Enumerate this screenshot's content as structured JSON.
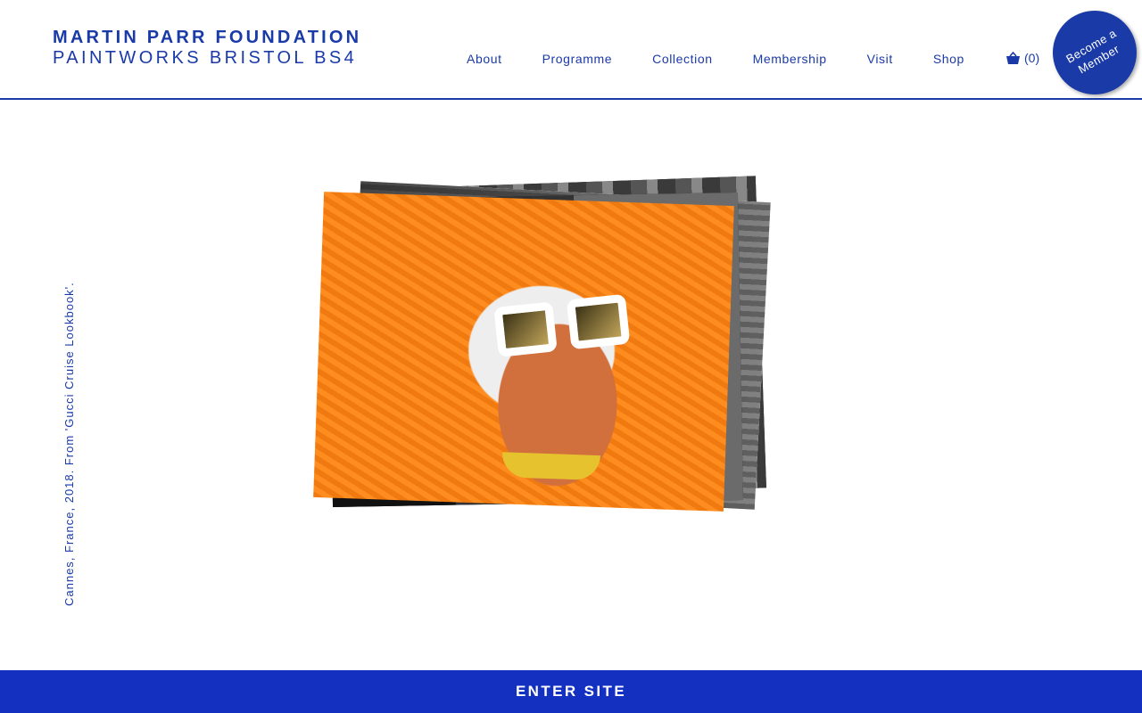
{
  "brand": {
    "line1": "MARTIN PARR FOUNDATION",
    "line2": "PAINTWORKS BRISTOL BS4"
  },
  "nav": {
    "items": [
      {
        "label": "About"
      },
      {
        "label": "Programme"
      },
      {
        "label": "Collection"
      },
      {
        "label": "Membership"
      },
      {
        "label": "Visit"
      },
      {
        "label": "Shop"
      }
    ]
  },
  "basket": {
    "icon": "basket-icon",
    "count_label": "(0)"
  },
  "member_badge": {
    "line1": "Become a",
    "line2": "Member"
  },
  "caption": {
    "text": "Cannes, France, 2018. From 'Gucci Cruise Lookbook'."
  },
  "enter": {
    "label": "ENTER SITE"
  },
  "colors": {
    "brand_blue": "#1a3aa8",
    "enter_bar": "#1330c0",
    "background": "#ffffff"
  }
}
